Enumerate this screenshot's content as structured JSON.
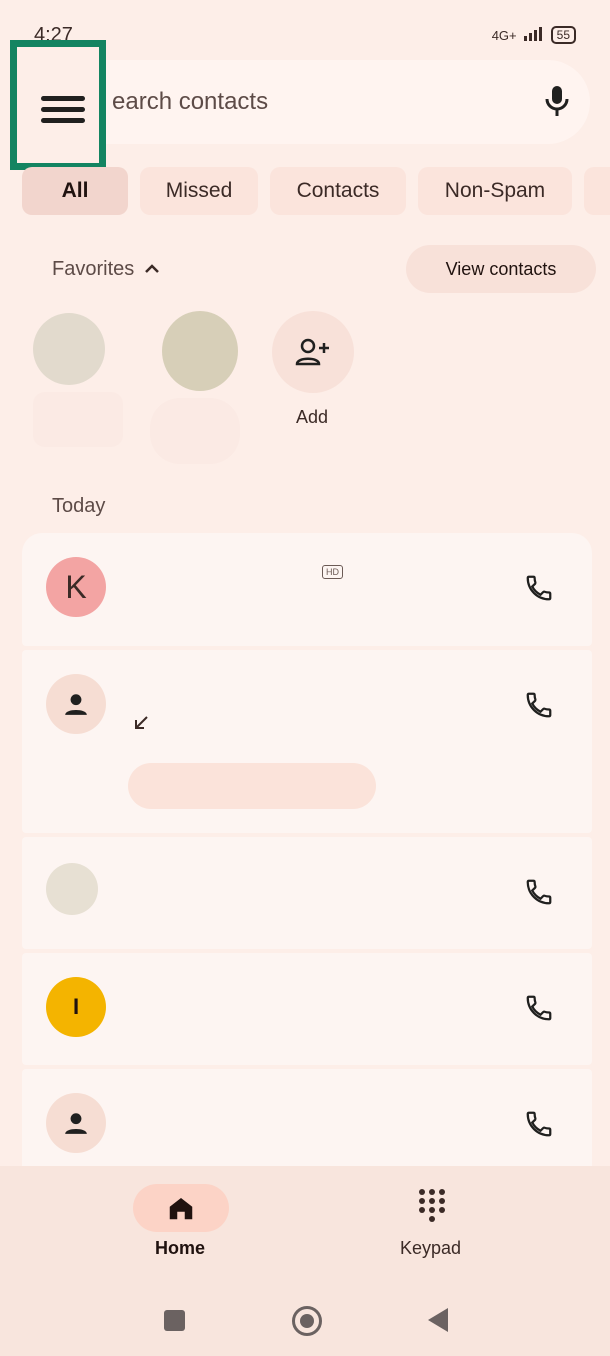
{
  "status_bar": {
    "time": "4:27",
    "network": "4G+",
    "battery": "55"
  },
  "search": {
    "placeholder": "earch contacts"
  },
  "filters": [
    "All",
    "Missed",
    "Contacts",
    "Non-Spam"
  ],
  "favorites": {
    "label": "Favorites",
    "view_contacts_label": "View contacts",
    "add_label": "Add"
  },
  "calls": {
    "section_title": "Today",
    "items": [
      {
        "avatar_letter": "K",
        "avatar_color": "#f3a4a3",
        "badge": "HD"
      },
      {
        "avatar_letter": "",
        "avatar_color": "#f6ddd3"
      },
      {
        "avatar_letter": "",
        "avatar_color": "#e7e0d3"
      },
      {
        "avatar_letter": "I",
        "avatar_color": "#f4b400"
      },
      {
        "avatar_letter": "",
        "avatar_color": "#f6ddd3"
      }
    ]
  },
  "bottom_nav": {
    "home": "Home",
    "keypad": "Keypad"
  },
  "colors": {
    "accent": "#138461",
    "background": "#fdeee8"
  }
}
